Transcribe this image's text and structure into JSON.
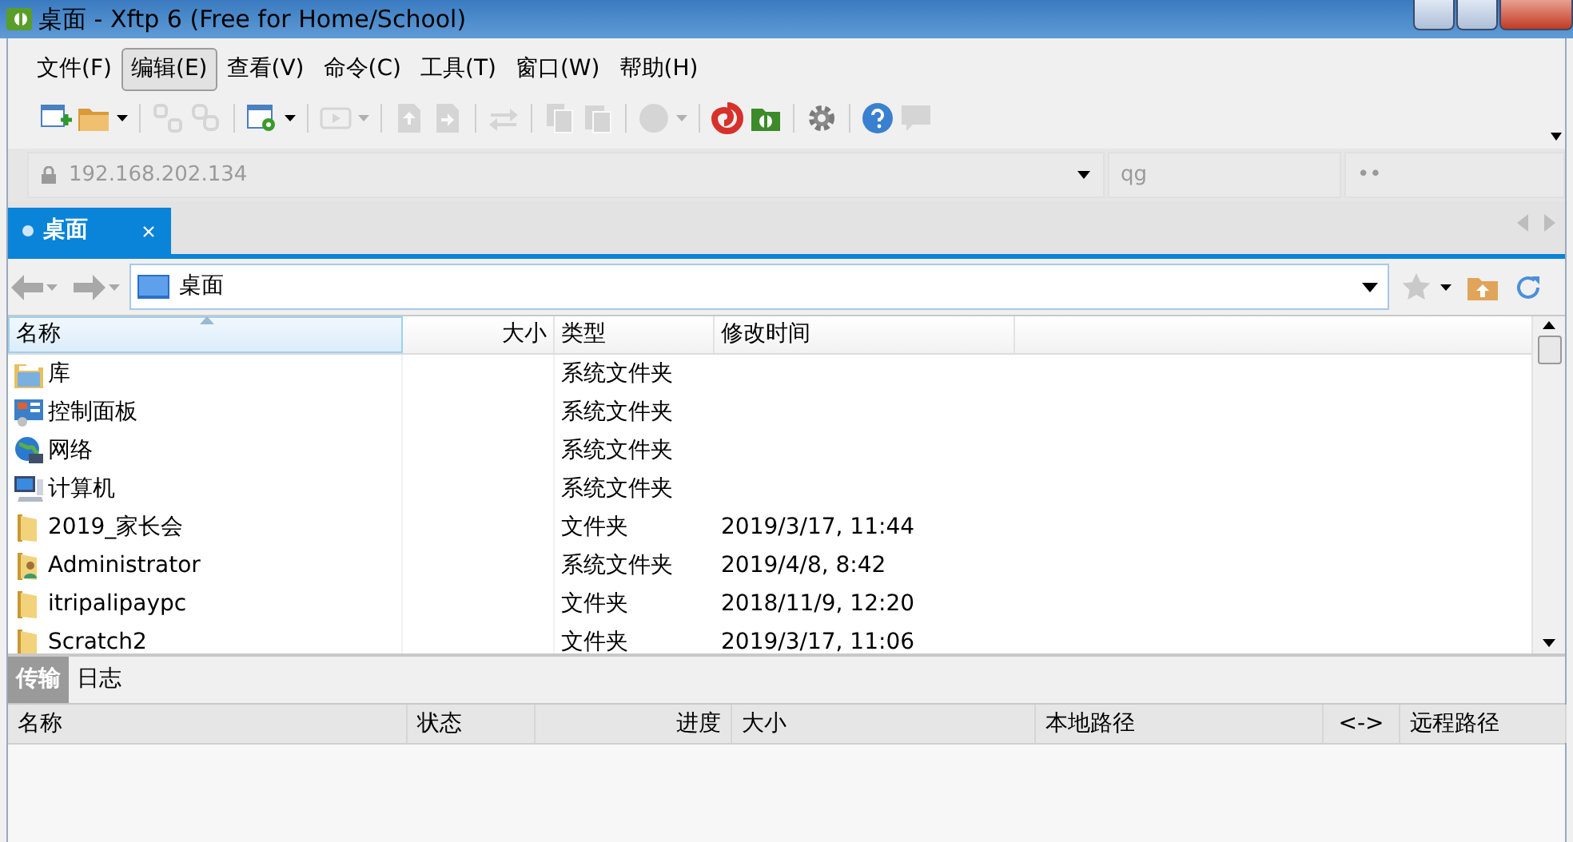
{
  "window": {
    "title": "桌面 - Xftp 6 (Free for Home/School)"
  },
  "menu": [
    {
      "label": "文件(F)",
      "selected": false
    },
    {
      "label": "编辑(E)",
      "selected": true
    },
    {
      "label": "查看(V)",
      "selected": false
    },
    {
      "label": "命令(C)",
      "selected": false
    },
    {
      "label": "工具(T)",
      "selected": false
    },
    {
      "label": "窗口(W)",
      "selected": false
    },
    {
      "label": "帮助(H)",
      "selected": false
    }
  ],
  "toolbar": [
    {
      "kind": "new-session",
      "disabled": false
    },
    {
      "kind": "folder",
      "disabled": false
    },
    {
      "kind": "caret",
      "disabled": false
    },
    {
      "kind": "separator"
    },
    {
      "kind": "disconnect",
      "disabled": true
    },
    {
      "kind": "link",
      "disabled": true
    },
    {
      "kind": "separator"
    },
    {
      "kind": "properties",
      "disabled": false
    },
    {
      "kind": "caret",
      "disabled": false
    },
    {
      "kind": "separator"
    },
    {
      "kind": "play",
      "disabled": true
    },
    {
      "kind": "caret",
      "disabled": true
    },
    {
      "kind": "separator"
    },
    {
      "kind": "upload",
      "disabled": true
    },
    {
      "kind": "download",
      "disabled": true
    },
    {
      "kind": "separator"
    },
    {
      "kind": "transfer",
      "disabled": true
    },
    {
      "kind": "separator"
    },
    {
      "kind": "copy",
      "disabled": true
    },
    {
      "kind": "paste",
      "disabled": true
    },
    {
      "kind": "separator"
    },
    {
      "kind": "circle",
      "disabled": true
    },
    {
      "kind": "caret",
      "disabled": true
    },
    {
      "kind": "separator"
    },
    {
      "kind": "swirl",
      "disabled": false
    },
    {
      "kind": "app",
      "disabled": false
    },
    {
      "kind": "separator"
    },
    {
      "kind": "gear",
      "disabled": false
    },
    {
      "kind": "separator"
    },
    {
      "kind": "help",
      "disabled": false
    },
    {
      "kind": "chat",
      "disabled": true
    }
  ],
  "address": {
    "host": "192.168.202.134",
    "user": "qg",
    "password": "••"
  },
  "tabs": [
    {
      "label": "桌面",
      "selected": true
    }
  ],
  "path": "桌面",
  "file_list": {
    "columns": [
      "名称",
      "大小",
      "类型",
      "修改时间"
    ],
    "rows": [
      {
        "kind": "library",
        "name": "库",
        "type": "系统文件夹"
      },
      {
        "kind": "control-panel",
        "name": "控制面板",
        "type": "系统文件夹"
      },
      {
        "kind": "network",
        "name": "网络",
        "type": "系统文件夹"
      },
      {
        "kind": "computer",
        "name": "计算机",
        "type": "系统文件夹"
      },
      {
        "kind": "folder",
        "name": "2019_家长会",
        "type": "文件夹",
        "modified": "2019/3/17, 11:44"
      },
      {
        "kind": "user-folder",
        "name": "Administrator",
        "type": "系统文件夹",
        "modified": "2019/4/8, 8:42"
      },
      {
        "kind": "folder",
        "name": "itripalipaypc",
        "type": "文件夹",
        "modified": "2018/11/9, 12:20"
      },
      {
        "kind": "folder",
        "name": "Scratch2",
        "type": "文件夹",
        "modified": "2019/3/17, 11:06"
      }
    ]
  },
  "transfer_tabs": [
    {
      "label": "传输",
      "selected": true
    },
    {
      "label": "日志",
      "selected": false
    }
  ],
  "transfer_columns": [
    "名称",
    "状态",
    "进度",
    "大小",
    "本地路径",
    "<->",
    "远程路径"
  ]
}
